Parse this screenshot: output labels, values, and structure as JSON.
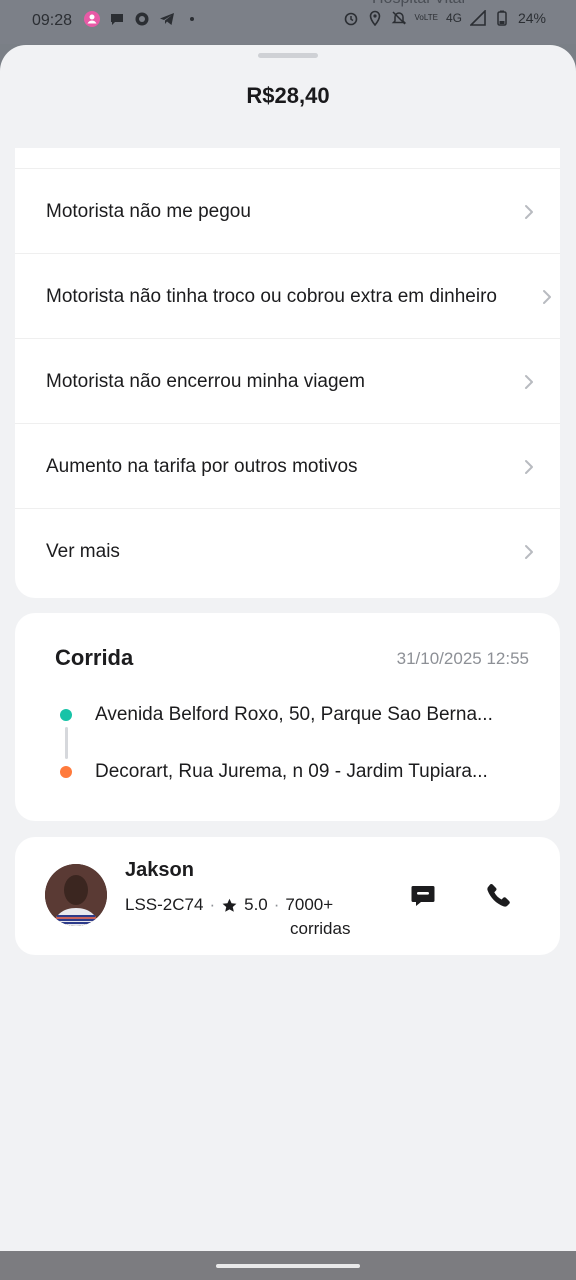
{
  "status_bar": {
    "time": "09:28",
    "ghost_text": "Hospital Vital",
    "network": "4G",
    "network_small": "VoLTE",
    "battery": "24%"
  },
  "sheet": {
    "price": "R$28,40"
  },
  "issues": [
    {
      "label": "Motorista não me pegou"
    },
    {
      "label": "Motorista não tinha troco ou cobrou extra em dinheiro"
    },
    {
      "label": "Motorista não encerrou minha viagem"
    },
    {
      "label": "Aumento na tarifa por outros motivos"
    },
    {
      "label": "Ver mais"
    }
  ],
  "ride": {
    "title": "Corrida",
    "datetime": "31/10/2025 12:55",
    "origin": "Avenida Belford Roxo, 50, Parque Sao Berna...",
    "destination": "Decorart, Rua Jurema, n 09 - Jardim Tupiara..."
  },
  "driver": {
    "name": "Jakson",
    "plate": "LSS-2C74",
    "rating": "5.0",
    "rides_count": "7000+",
    "rides_label": "corridas"
  },
  "colors": {
    "accent_origin": "#17c3a7",
    "accent_destination": "#ff7a3c"
  }
}
